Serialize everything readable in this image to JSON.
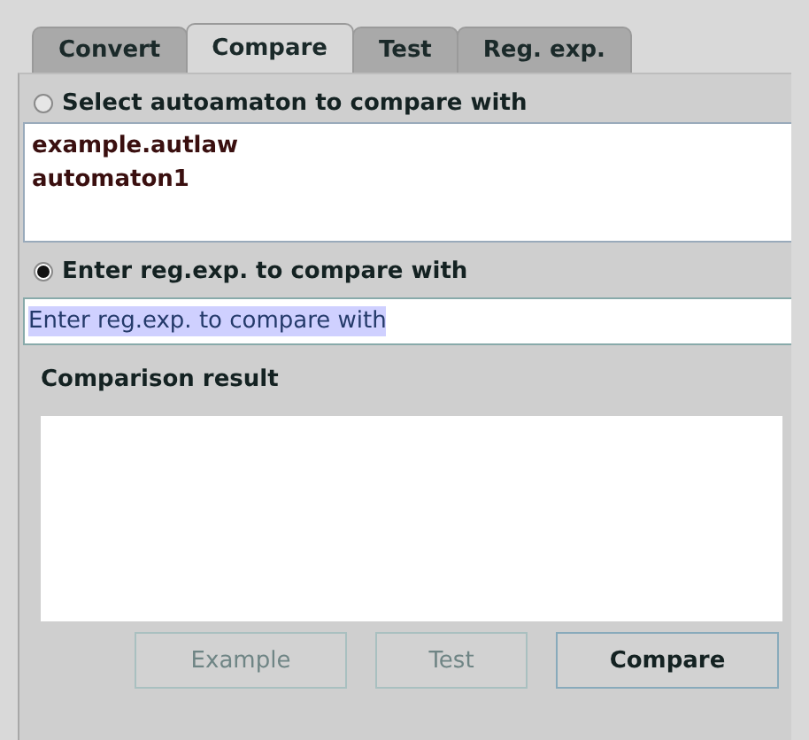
{
  "tabs": [
    {
      "label": "Convert",
      "selected": false
    },
    {
      "label": "Compare",
      "selected": true
    },
    {
      "label": "Test",
      "selected": false
    },
    {
      "label": "Reg. exp.",
      "selected": false
    }
  ],
  "automaton_option": {
    "label": "Select autoamaton to compare with",
    "selected": false
  },
  "automata_list": [
    "example.autlaw",
    "automaton1"
  ],
  "regexp_option": {
    "label": "Enter reg.exp. to compare with",
    "selected": true
  },
  "regexp_field": {
    "value": "Enter reg.exp. to compare with",
    "text_selected": true
  },
  "result": {
    "label": "Comparison result"
  },
  "buttons": [
    {
      "label": "Example",
      "disabled": true
    },
    {
      "label": "Test",
      "disabled": true
    },
    {
      "label": "Compare",
      "disabled": false
    }
  ]
}
